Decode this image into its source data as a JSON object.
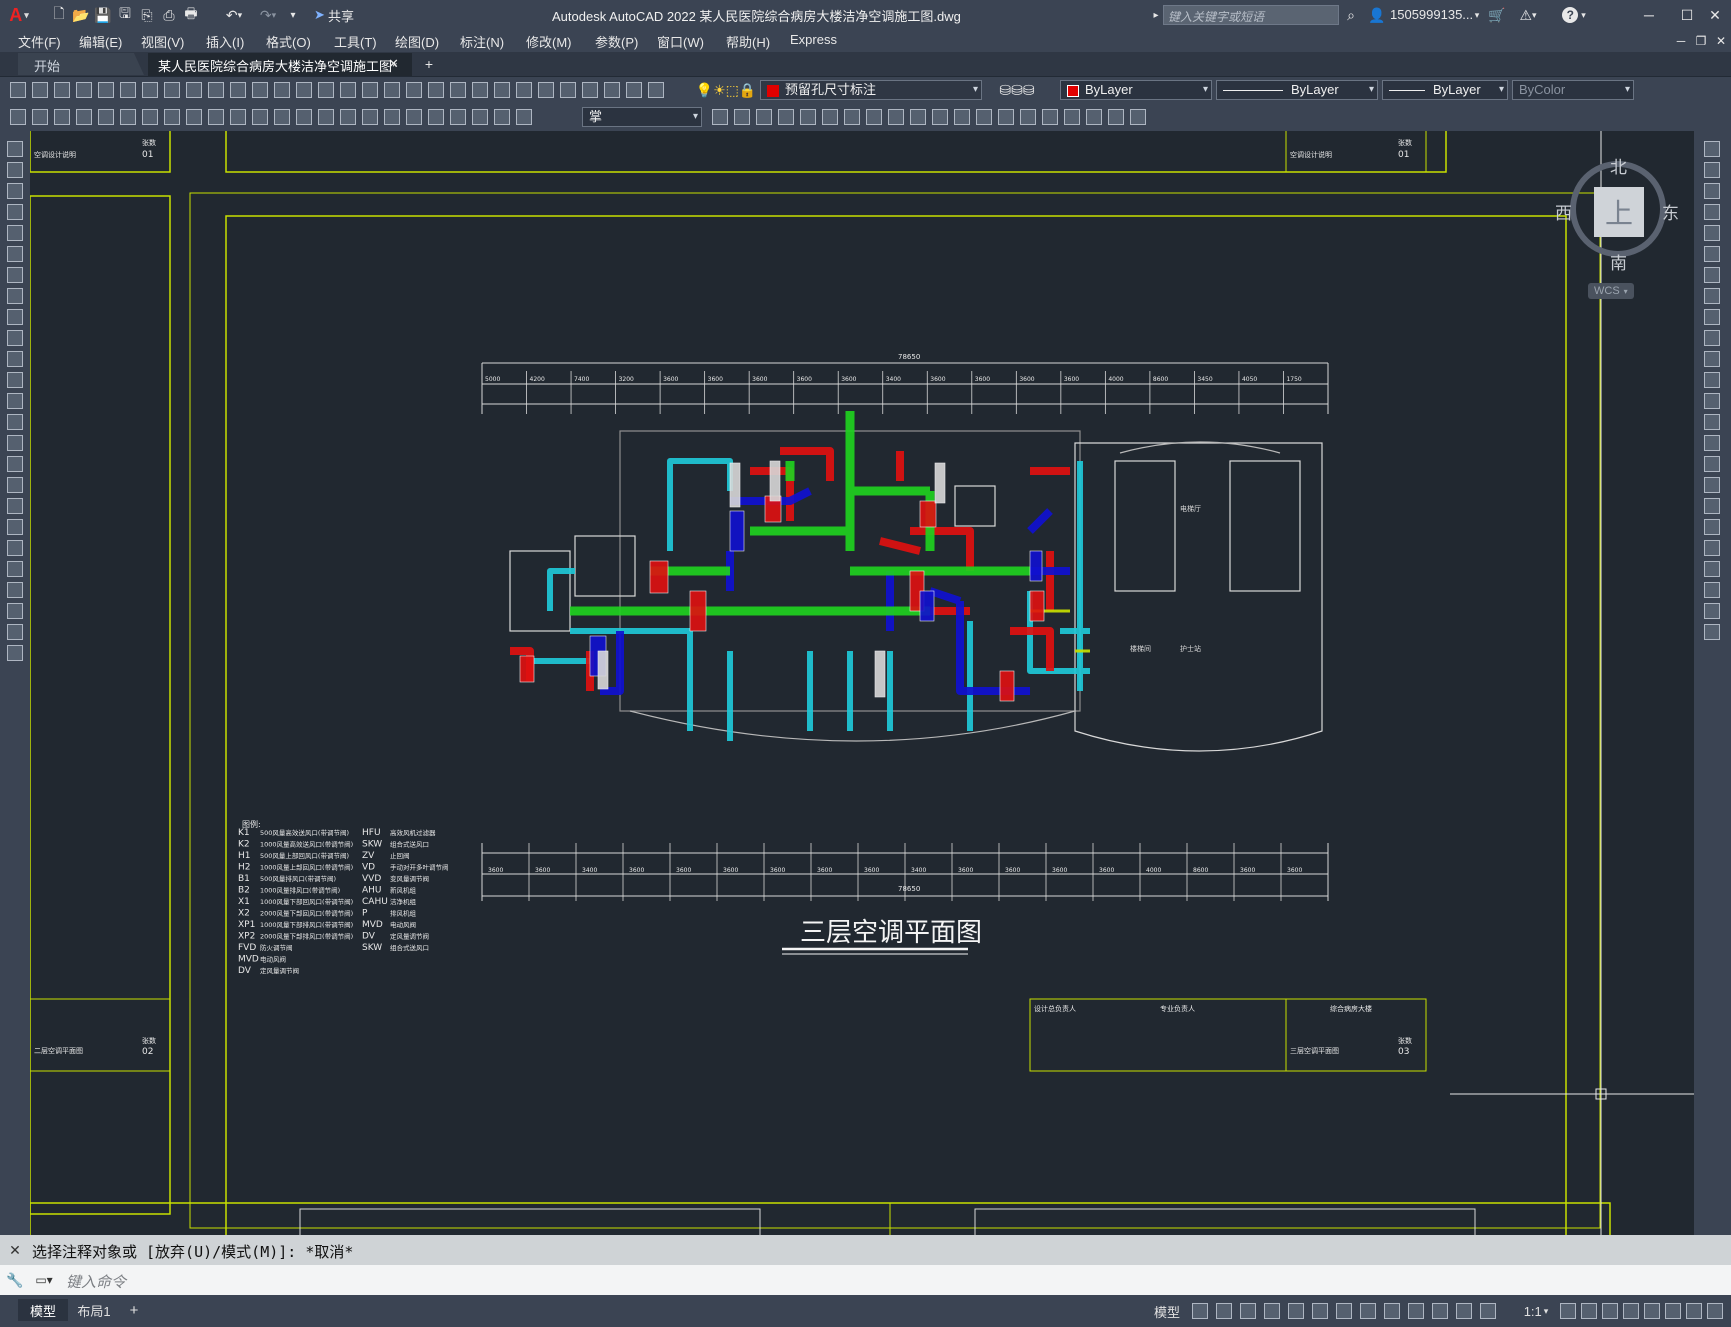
{
  "app": {
    "title": "Autodesk AutoCAD 2022    某人民医院综合病房大楼洁净空调施工图.dwg",
    "share_label": "共享",
    "search_placeholder": "键入关键字或短语",
    "user": "1505999135...",
    "help": "?"
  },
  "menu": [
    "文件(F)",
    "编辑(E)",
    "视图(V)",
    "插入(I)",
    "格式(O)",
    "工具(T)",
    "绘图(D)",
    "标注(N)",
    "修改(M)",
    "参数(P)",
    "窗口(W)",
    "帮助(H)",
    "Express"
  ],
  "tabs": {
    "start": "开始",
    "active": "某人民医院综合病房大楼洁净空调施工图*",
    "add": "+"
  },
  "toolbar": {
    "layer": "预留孔尺寸标注",
    "color": "ByLayer",
    "linetype": "ByLayer",
    "lineweight": "ByLayer",
    "plotstyle": "ByColor",
    "textstyle": "掌",
    "layer_color": "#e00000"
  },
  "viewcube": {
    "north": "北",
    "south": "南",
    "east": "东",
    "west": "西",
    "top": "上",
    "wcs": "WCS"
  },
  "drawing": {
    "plan_title": "三层空调平面图",
    "legend_title": "图例:",
    "legend_left": [
      {
        "code": "K1",
        "desc": "500风量高效送风口(带调节阀)"
      },
      {
        "code": "K2",
        "desc": "1000风量高效送风口(带调节阀)"
      },
      {
        "code": "H1",
        "desc": "500风量上部回风口(带调节阀)"
      },
      {
        "code": "H2",
        "desc": "1000风量上部回风口(带调节阀)"
      },
      {
        "code": "B1",
        "desc": "500风量排风口(带调节阀)"
      },
      {
        "code": "B2",
        "desc": "1000风量排风口(带调节阀)"
      },
      {
        "code": "X1",
        "desc": "1000风量下部回风口(带调节阀)"
      },
      {
        "code": "X2",
        "desc": "2000风量下部回风口(带调节阀)"
      },
      {
        "code": "XP1",
        "desc": "1000风量下部排风口(带调节阀)"
      },
      {
        "code": "XP2",
        "desc": "2000风量下部排风口(带调节阀)"
      },
      {
        "code": "FVD",
        "desc": "防火调节阀"
      },
      {
        "code": "MVD",
        "desc": "电动风阀"
      },
      {
        "code": "DV",
        "desc": "定风量调节阀"
      }
    ],
    "legend_right": [
      {
        "code": "HFU",
        "desc": "高效风机过滤器"
      },
      {
        "code": "SKW",
        "desc": "组合式送风口"
      },
      {
        "code": "ZV",
        "desc": "止回阀"
      },
      {
        "code": "VD",
        "desc": "手动对开多叶调节阀"
      },
      {
        "code": "VVD",
        "desc": "变风量调节阀"
      },
      {
        "code": "AHU",
        "desc": "新风机组"
      },
      {
        "code": "CAHU",
        "desc": "洁净机组"
      },
      {
        "code": "P",
        "desc": "排风机组"
      },
      {
        "code": "MVD",
        "desc": "电动风阀"
      },
      {
        "code": "DV",
        "desc": "定风量调节阀"
      },
      {
        "code": "SKW",
        "desc": "组合式送风口"
      }
    ],
    "dims_top_total": "78650",
    "dims_top_row1": [
      "5000",
      "4200",
      "7400",
      "3200",
      "3600",
      "3600",
      "3600",
      "3600",
      "3600",
      "3400",
      "3600",
      "3600",
      "3600",
      "3600",
      "4000",
      "8600",
      "3450",
      "4050",
      "1750"
    ],
    "dims_bottom_total": "78650",
    "dims_bottom_row1": [
      "3600",
      "3600",
      "3400",
      "3600",
      "3600",
      "3600",
      "3600",
      "3600",
      "3600",
      "3400",
      "3600",
      "3600",
      "3600",
      "3600",
      "4000",
      "8600",
      "3600",
      "3600"
    ],
    "title_blocks": [
      {
        "name": "空调设计说明",
        "sheet": "01"
      },
      {
        "name": "空调设计说明",
        "sheet": "01"
      },
      {
        "name": "二层空调平面图",
        "sheet": "02"
      },
      {
        "name": "三层空调平面图",
        "sheet": "03"
      }
    ],
    "tb_labels": {
      "page": "张数",
      "project": "综合病房大楼",
      "designer": "设计总负责人",
      "school": "专业负责人"
    },
    "room_labels": {
      "elevator_hall": "电梯厅",
      "lobby": "楼梯间",
      "nurse": "护士站"
    }
  },
  "command": {
    "history": "选择注释对象或 [放弃(U)/模式(M)]: *取消*",
    "placeholder": "键入命令"
  },
  "status": {
    "model": "模型",
    "layout1": "布局1",
    "add": "+",
    "model_btn": "模型",
    "scale": "1:1"
  },
  "colors": {
    "duct_red": "#e01010",
    "duct_blue": "#1010d0",
    "duct_green": "#20d020",
    "duct_cyan": "#20c8d8",
    "frame": "#c8e000",
    "white_line": "#d8d8d8"
  }
}
